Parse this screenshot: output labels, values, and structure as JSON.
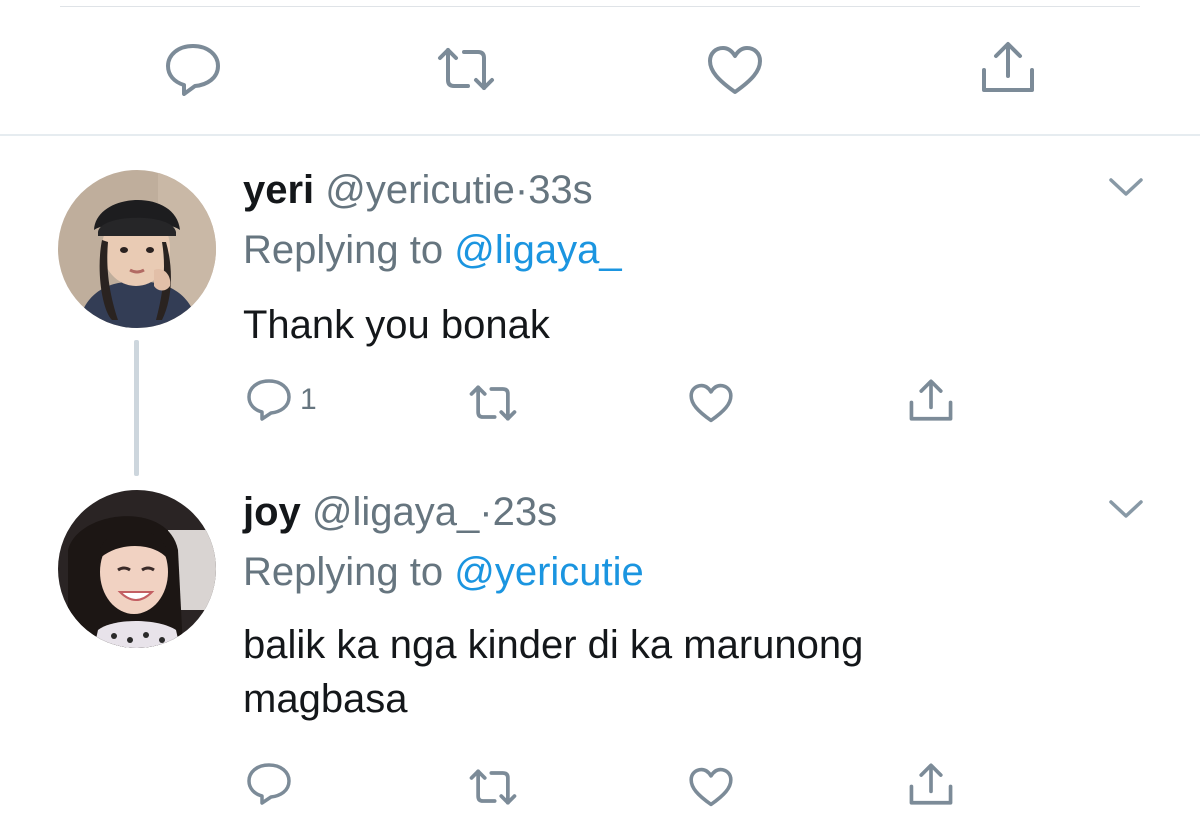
{
  "top_actions": {
    "reply_icon": "reply-icon",
    "retweet_icon": "retweet-icon",
    "like_icon": "heart-icon",
    "share_icon": "share-icon"
  },
  "tweets": [
    {
      "name": "yeri",
      "handle": "@yericutie",
      "separator": "·",
      "time": "33s",
      "replying_prefix": "Replying to",
      "replying_to": "@ligaya_",
      "text": "Thank you bonak",
      "reply_count": "1"
    },
    {
      "name": "joy",
      "handle": "@ligaya_",
      "separator": "·",
      "time": "23s",
      "replying_prefix": "Replying to",
      "replying_to": "@yericutie",
      "text": "balik ka nga kinder di ka marunong magbasa",
      "reply_count": ""
    }
  ],
  "colors": {
    "link": "#1b95e0",
    "secondary_text": "#66757f",
    "icon": "#7c8b98",
    "divider": "#e6ecf0"
  }
}
